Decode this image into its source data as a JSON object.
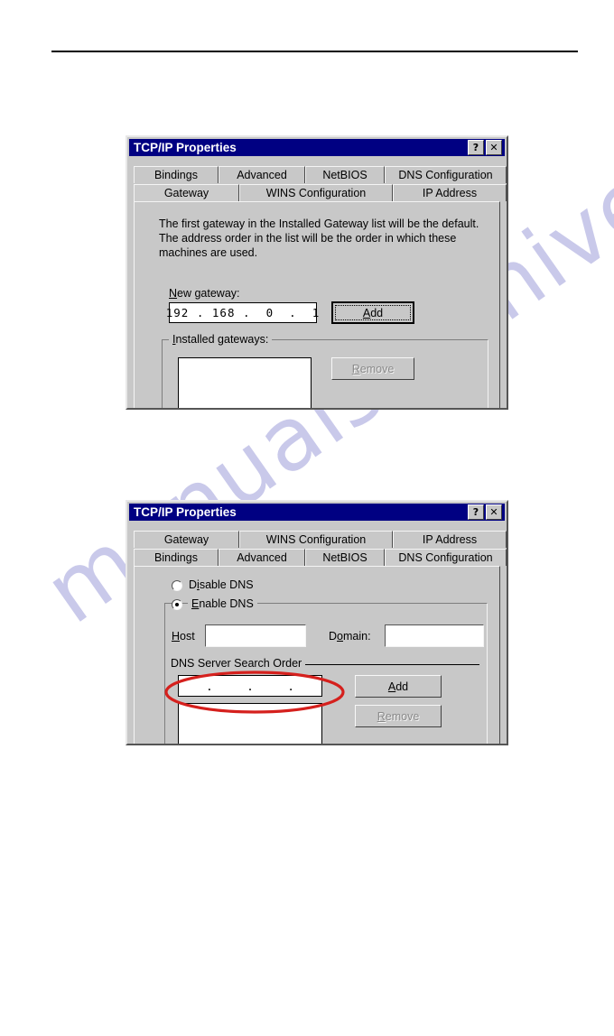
{
  "page": {
    "watermark_text": "manualsarchive.com",
    "watermark_color": "#c9c9ea",
    "rule_color": "#000000"
  },
  "dialog1": {
    "title": "TCP/IP Properties",
    "titlebar_color": "#000082",
    "help_button": "?",
    "close_button": "✕",
    "tabs_row1": [
      {
        "label": "Bindings",
        "selected": false
      },
      {
        "label": "Advanced",
        "selected": false
      },
      {
        "label": "NetBIOS",
        "selected": false
      },
      {
        "label": "DNS Configuration",
        "selected": false
      }
    ],
    "tabs_row2": [
      {
        "label": "Gateway",
        "selected": true
      },
      {
        "label": "WINS Configuration",
        "selected": false
      },
      {
        "label": "IP Address",
        "selected": false
      }
    ],
    "description": "The first gateway in the Installed Gateway list will be the default. The address order in the list will be the order in which these machines are used.",
    "new_gateway_label": "New gateway:",
    "new_gateway_value": "192 . 168 .  0  .  1",
    "add_button": "Add",
    "installed_gateways_label": "Installed gateways:",
    "installed_gateways_items": [],
    "remove_button": "Remove",
    "remove_disabled": true
  },
  "dialog2": {
    "title": "TCP/IP Properties",
    "titlebar_color": "#000082",
    "help_button": "?",
    "close_button": "✕",
    "tabs_row1": [
      {
        "label": "Gateway",
        "selected": false
      },
      {
        "label": "WINS Configuration",
        "selected": false
      },
      {
        "label": "IP Address",
        "selected": false
      }
    ],
    "tabs_row2": [
      {
        "label": "Bindings",
        "selected": false
      },
      {
        "label": "Advanced",
        "selected": false
      },
      {
        "label": "NetBIOS",
        "selected": false
      },
      {
        "label": "DNS Configuration",
        "selected": true
      }
    ],
    "disable_dns_label": "Disable DNS",
    "disable_dns_selected": false,
    "enable_dns_label": "Enable DNS",
    "enable_dns_selected": true,
    "host_label": "Host",
    "host_value": "",
    "domain_label": "Domain:",
    "domain_value": "",
    "search_order_label": "DNS Server Search Order",
    "search_order_value": "  .     .     .  ",
    "search_order_items": [],
    "add_button": "Add",
    "remove_button": "Remove",
    "remove_disabled": true,
    "annotation_color": "#d5201d"
  }
}
